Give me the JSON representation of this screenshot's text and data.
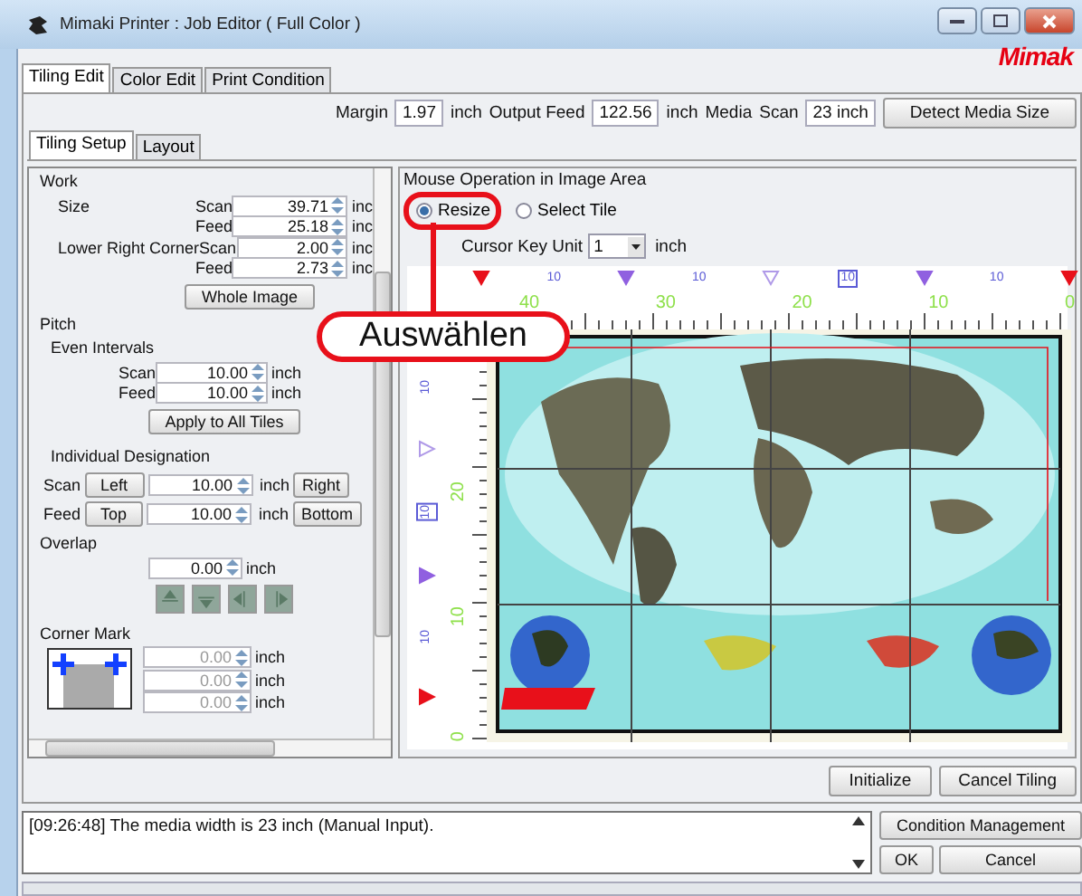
{
  "window": {
    "title": "Mimaki Printer : Job Editor ( Full Color )",
    "logo": "Mimak"
  },
  "tabs": [
    {
      "label": "Tiling Edit",
      "selected": true
    },
    {
      "label": "Color Edit",
      "selected": false
    },
    {
      "label": "Print Condition",
      "selected": false
    }
  ],
  "media_bar": {
    "items": [
      {
        "kind": "label",
        "text": "Margin"
      },
      {
        "kind": "field",
        "text": "1.97"
      },
      {
        "kind": "label",
        "text": "inch"
      },
      {
        "kind": "label",
        "text": "Output Feed"
      },
      {
        "kind": "field",
        "text": "122.56"
      },
      {
        "kind": "label",
        "text": "inch"
      },
      {
        "kind": "label",
        "text": "Media"
      },
      {
        "kind": "label",
        "text": "Scan"
      },
      {
        "kind": "field",
        "text": "23 inch"
      }
    ],
    "button": "Detect Media Size"
  },
  "sub_tabs": [
    {
      "label": "Tiling Setup",
      "selected": true
    },
    {
      "label": "Layout",
      "selected": false
    }
  ],
  "settings_panel": {
    "work": {
      "title": "Work",
      "rows": [
        {
          "label": "Size",
          "axis": "Scan",
          "value": "39.71",
          "unit": "inc",
          "disabled": false
        },
        {
          "label": "",
          "axis": "Feed",
          "value": "25.18",
          "unit": "inc",
          "disabled": false
        },
        {
          "label": "Lower Right Corner",
          "axis": "Scan",
          "value": "2.00",
          "unit": "inc",
          "disabled": false
        },
        {
          "label": "",
          "axis": "Feed",
          "value": "2.73",
          "unit": "inc",
          "disabled": false
        }
      ],
      "button": "Whole Image"
    },
    "pitch": {
      "title": "Pitch",
      "even_title": "Even Intervals",
      "even_rows": [
        {
          "axis": "Scan",
          "value": "10.00",
          "unit": "inch",
          "disabled": false
        },
        {
          "axis": "Feed",
          "value": "10.00",
          "unit": "inch",
          "disabled": false
        }
      ],
      "apply_button": "Apply to All Tiles",
      "individual_title": "Individual Designation",
      "individual_rows": [
        {
          "axis": "Scan",
          "before": "Left",
          "value": "10.00",
          "unit": "inch",
          "after": "Right",
          "disabled": false
        },
        {
          "axis": "Feed",
          "before": "Top",
          "value": "10.00",
          "unit": "inch",
          "after": "Bottom",
          "disabled": false
        }
      ]
    },
    "overlap": {
      "title": "Overlap",
      "value": "0.00",
      "unit": "inch",
      "disabled": false,
      "icon_buttons": [
        {
          "kind": "top"
        },
        {
          "kind": "bottom"
        },
        {
          "kind": "left"
        },
        {
          "kind": "right"
        }
      ]
    },
    "corner_mark": {
      "title": "Corner Mark",
      "fields": [
        {
          "value": "0.00",
          "unit": "inch",
          "disabled": true
        },
        {
          "value": "0.00",
          "unit": "inch",
          "disabled": true
        },
        {
          "value": "0.00",
          "unit": "inch",
          "disabled": true
        }
      ]
    }
  },
  "image_area": {
    "title": "Mouse Operation in Image Area",
    "modes": [
      {
        "label": "Resize",
        "selected": true
      },
      {
        "label": "Select Tile",
        "selected": false
      }
    ],
    "cursor_key_unit": {
      "label": "Cursor Key Unit",
      "value": "1",
      "unit": "inch"
    },
    "top_ruler": {
      "markers": [
        {
          "kind": "start"
        },
        {
          "kind": "label",
          "text": "10"
        },
        {
          "kind": "tile"
        },
        {
          "kind": "label",
          "text": "10"
        },
        {
          "kind": "hollow"
        },
        {
          "kind": "boxed",
          "text": "10"
        },
        {
          "kind": "tile"
        },
        {
          "kind": "label",
          "text": "10"
        },
        {
          "kind": "start"
        }
      ],
      "numbers": [
        "40",
        "30",
        "20",
        "10",
        "0"
      ]
    },
    "left_ruler": {
      "markers": [
        {
          "kind": "label",
          "text": "10"
        },
        {
          "kind": "hollow"
        },
        {
          "kind": "boxed",
          "text": "10"
        },
        {
          "kind": "tile"
        },
        {
          "kind": "label",
          "text": "10"
        },
        {
          "kind": "start"
        }
      ],
      "numbers": [
        "20",
        "10",
        "0"
      ]
    }
  },
  "tiling_buttons": [
    "Initialize",
    "Cancel Tiling"
  ],
  "log": {
    "lines": [
      "[09:26:48] The media width is 23 inch (Manual Input)."
    ]
  },
  "dialog_buttons": [
    "Condition Management",
    "OK",
    "Cancel"
  ],
  "callout": {
    "text": "Auswählen"
  }
}
